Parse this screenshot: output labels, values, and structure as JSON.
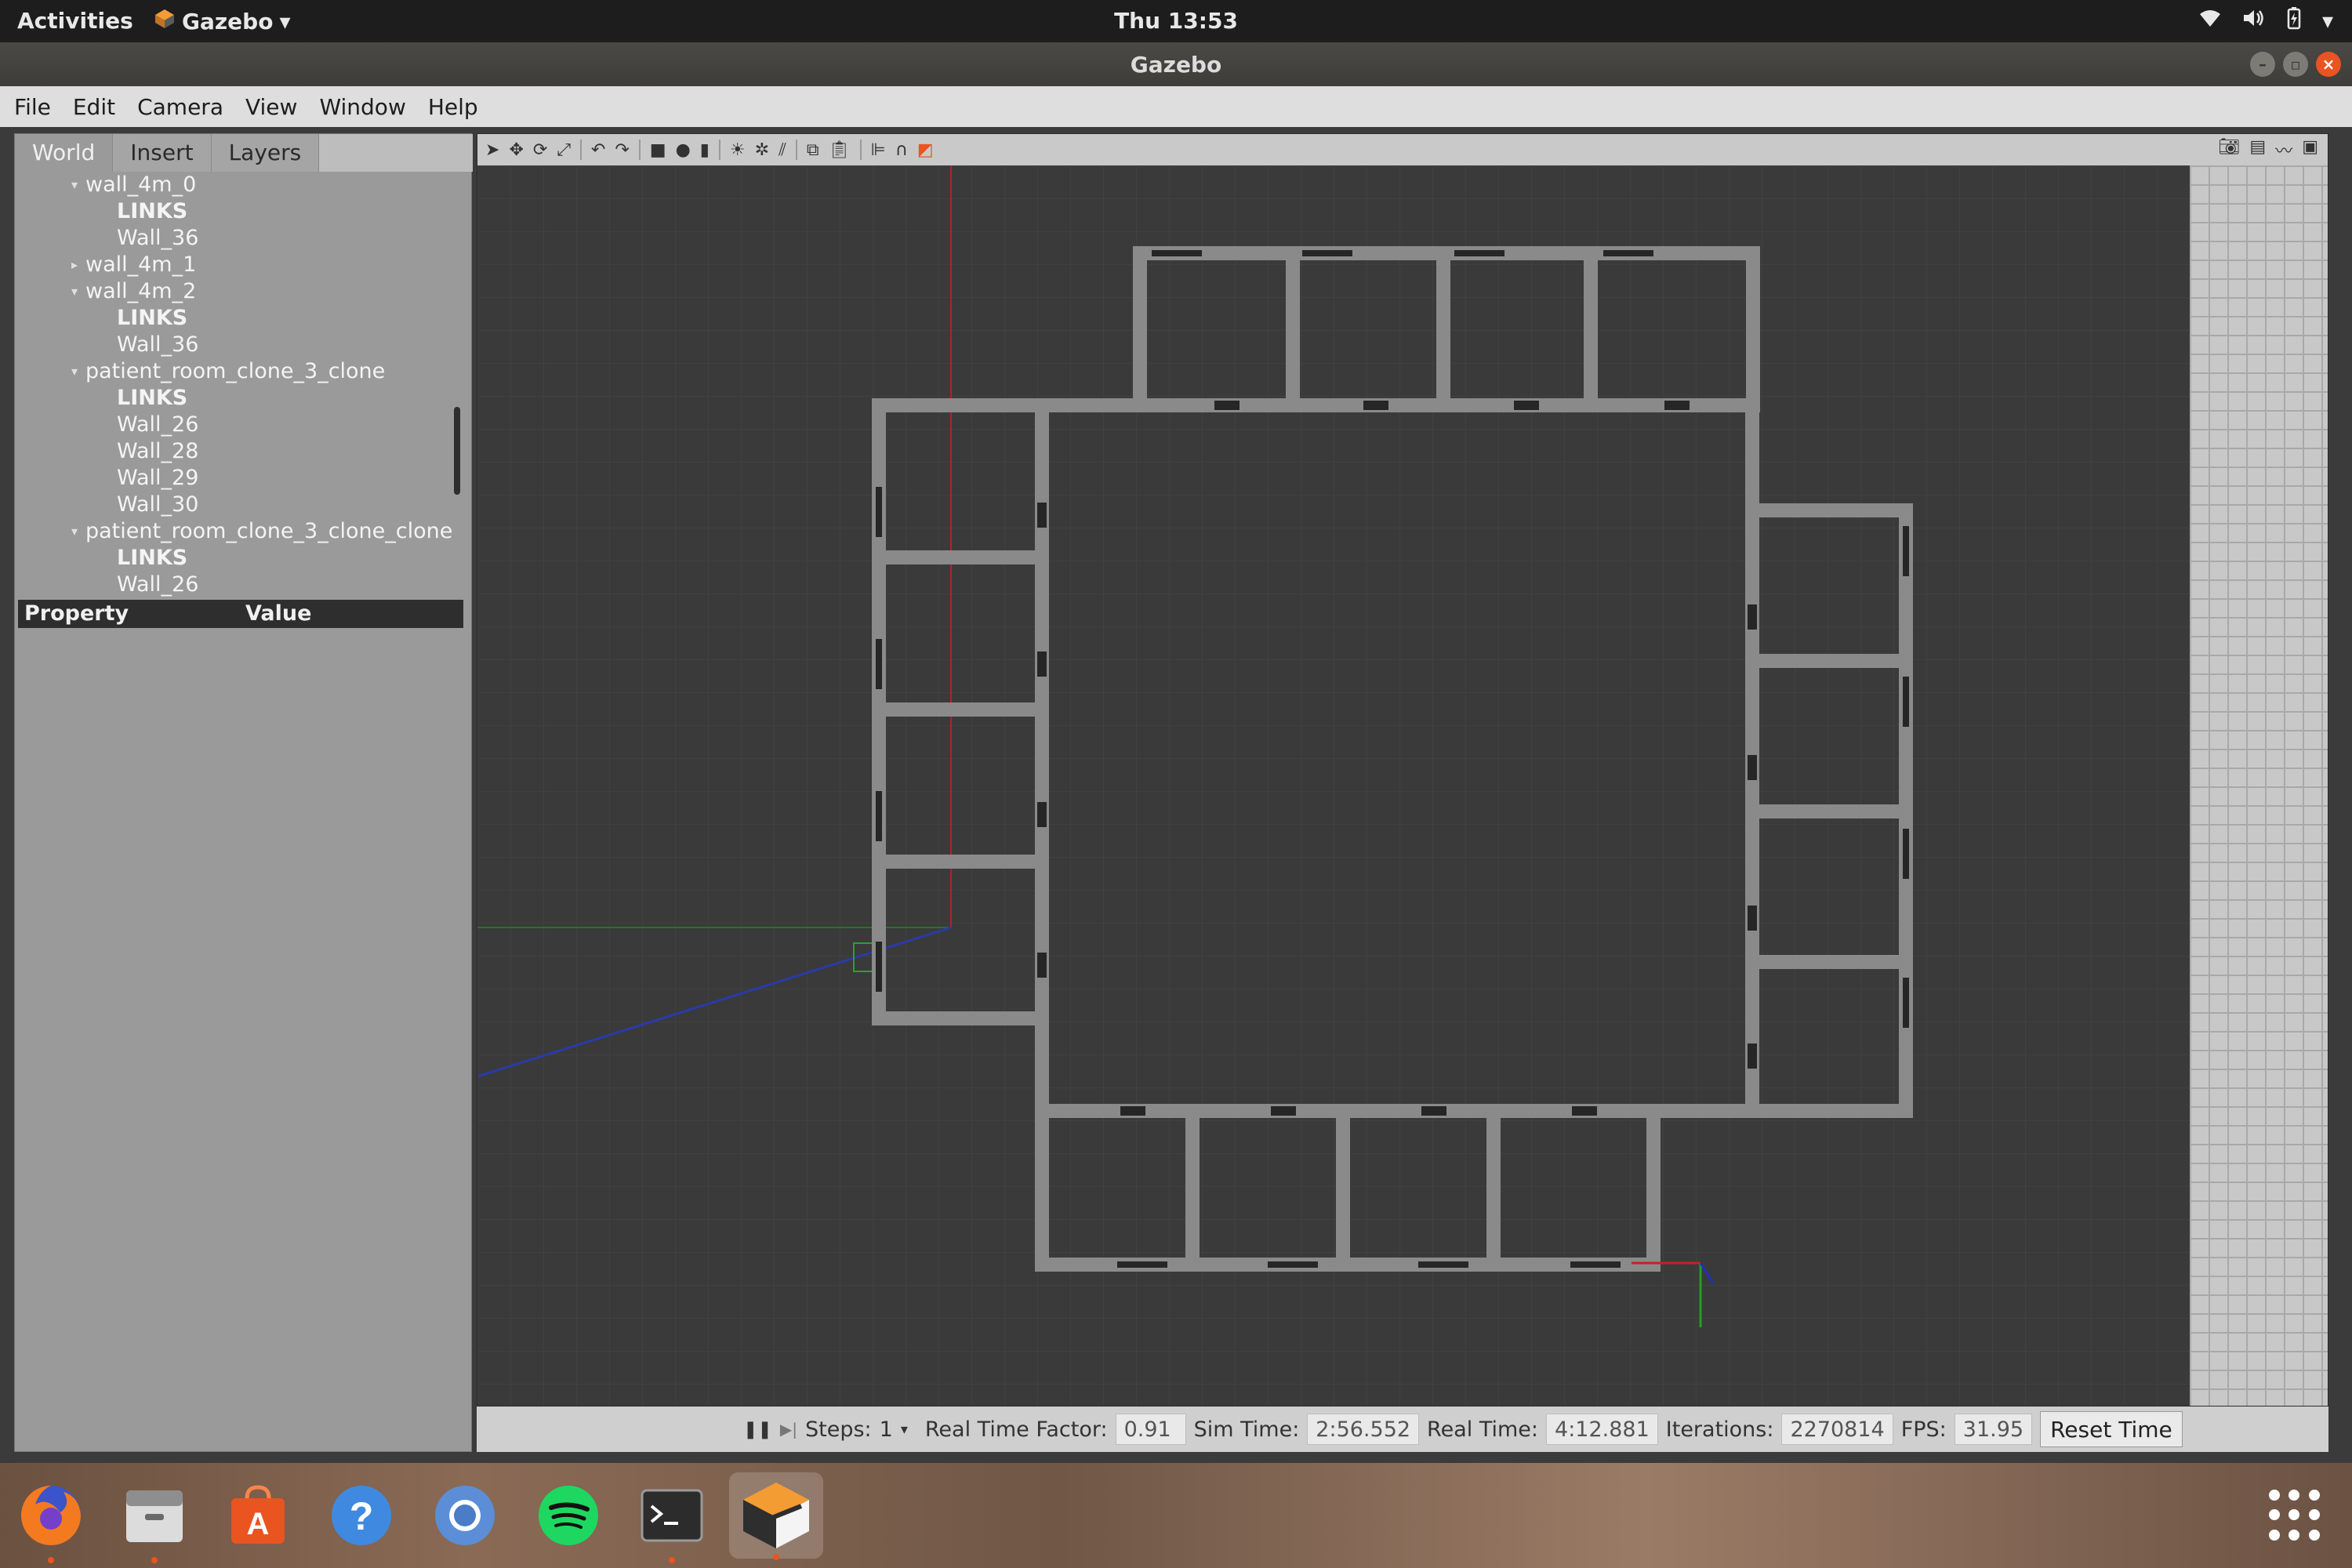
{
  "topbar": {
    "activities": "Activities",
    "app_name": "Gazebo",
    "clock": "Thu 13:53"
  },
  "window": {
    "title": "Gazebo"
  },
  "menu": {
    "items": [
      "File",
      "Edit",
      "Camera",
      "View",
      "Window",
      "Help"
    ]
  },
  "left_panel": {
    "tabs": [
      "World",
      "Insert",
      "Layers"
    ],
    "active_tab": "World",
    "tree": [
      {
        "label": "wall_4m_0",
        "depth": 0,
        "expanded": true
      },
      {
        "label": "LINKS",
        "depth": 1,
        "bold": true
      },
      {
        "label": "Wall_36",
        "depth": 1
      },
      {
        "label": "wall_4m_1",
        "depth": 0,
        "expanded": false
      },
      {
        "label": "wall_4m_2",
        "depth": 0,
        "expanded": true
      },
      {
        "label": "LINKS",
        "depth": 1,
        "bold": true
      },
      {
        "label": "Wall_36",
        "depth": 1
      },
      {
        "label": "patient_room_clone_3_clone",
        "depth": 0,
        "expanded": true
      },
      {
        "label": "LINKS",
        "depth": 1,
        "bold": true
      },
      {
        "label": "Wall_26",
        "depth": 1
      },
      {
        "label": "Wall_28",
        "depth": 1
      },
      {
        "label": "Wall_29",
        "depth": 1
      },
      {
        "label": "Wall_30",
        "depth": 1
      },
      {
        "label": "patient_room_clone_3_clone_clone",
        "depth": 0,
        "expanded": true
      },
      {
        "label": "LINKS",
        "depth": 1,
        "bold": true
      },
      {
        "label": "Wall_26",
        "depth": 1
      }
    ],
    "property_header": {
      "property": "Property",
      "value": "Value"
    }
  },
  "status": {
    "steps_label": "Steps:",
    "steps_value": "1",
    "rtf_label": "Real Time Factor:",
    "rtf_value": "0.91",
    "sim_time_label": "Sim Time:",
    "sim_time_value": "2:56.552",
    "real_time_label": "Real Time:",
    "real_time_value": "4:12.881",
    "iterations_label": "Iterations:",
    "iterations_value": "2270814",
    "fps_label": "FPS:",
    "fps_value": "31.95",
    "reset_label": "Reset Time"
  },
  "dock": {
    "apps": [
      "firefox-icon",
      "files-icon",
      "software-icon",
      "help-icon",
      "chromium-icon",
      "spotify-icon",
      "terminal-icon",
      "gazebo-icon"
    ],
    "active": "gazebo-icon"
  },
  "colors": {
    "accent": "#e95420",
    "viewport_bg": "#3a3a3a",
    "wall": "#8a8a8a",
    "wall_edge": "#bdbdbd"
  }
}
